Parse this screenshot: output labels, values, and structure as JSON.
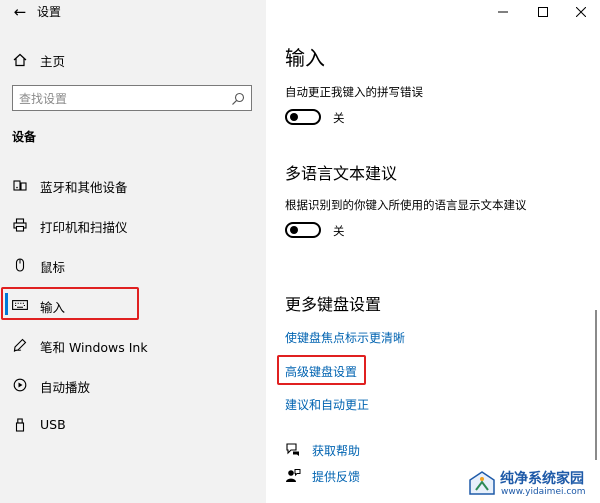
{
  "window": {
    "title": "设置",
    "back_glyph": "←",
    "controls": [
      "minimize",
      "maximize",
      "close"
    ]
  },
  "sidebar": {
    "home_label": "主页",
    "search_placeholder": "查找设置",
    "section_title": "设备",
    "items": [
      {
        "label": "蓝牙和其他设备",
        "icon": "bluetooth-devices-icon"
      },
      {
        "label": "打印机和扫描仪",
        "icon": "printer-icon"
      },
      {
        "label": "鼠标",
        "icon": "mouse-icon"
      },
      {
        "label": "输入",
        "icon": "keyboard-icon",
        "selected": true
      },
      {
        "label": "笔和 Windows Ink",
        "icon": "pen-icon"
      },
      {
        "label": "自动播放",
        "icon": "autoplay-icon"
      },
      {
        "label": "USB",
        "icon": "usb-icon"
      }
    ]
  },
  "main": {
    "title": "输入",
    "autocorrect": {
      "label": "自动更正我键入的拼写错误",
      "state": "关"
    },
    "multilingual": {
      "heading": "多语言文本建议",
      "label": "根据识别到的你键入所使用的语言显示文本建议",
      "state": "关"
    },
    "more_keyboard": {
      "heading": "更多键盘设置",
      "links": [
        "使键盘焦点标示更清晰",
        "高级键盘设置",
        "建议和自动更正"
      ]
    },
    "help": {
      "get_help": "获取帮助",
      "feedback": "提供反馈"
    }
  },
  "watermark": {
    "title": "纯净系统家园",
    "url": "www.yidaimei.com"
  },
  "colors": {
    "sidebar_bg": "#f2f2f2",
    "link": "#0063b1",
    "accent": "#0078d7",
    "highlight_box": "#e02020"
  }
}
